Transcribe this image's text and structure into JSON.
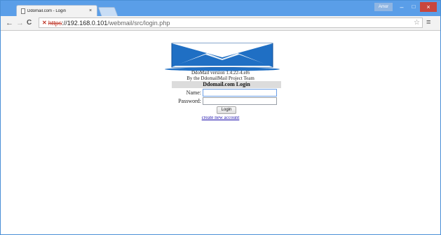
{
  "window": {
    "tab_title": "Ddomail.com - Login",
    "tab_close": "×",
    "user_badge": "Amor",
    "minimize": "–",
    "maximize": "□",
    "close": "×"
  },
  "toolbar": {
    "back": "←",
    "forward": "→",
    "reload": "C",
    "url_scheme": "https",
    "url_host": "://192.168.0.101",
    "url_path": "/webmail/src/login.php",
    "star": "☆",
    "menu": "≡"
  },
  "page": {
    "version_text": "DdoMail version 1.4.22-4.el6",
    "credit_text": "By the DdomailMail Project Team",
    "login_title": "Ddomail.com Login",
    "name_label": "Name:",
    "name_value": "",
    "password_label": "Password:",
    "password_value": "",
    "login_button": "Login",
    "create_account_link": "create new account"
  },
  "colors": {
    "frame_blue": "#5a9ee8",
    "logo_blue": "#1f6fc4",
    "link": "#1a0dab",
    "insecure_red": "#c0392b"
  },
  "icons": [
    "page-icon",
    "insecure-icon",
    "star-icon",
    "menu-icon",
    "envelope-logo"
  ]
}
